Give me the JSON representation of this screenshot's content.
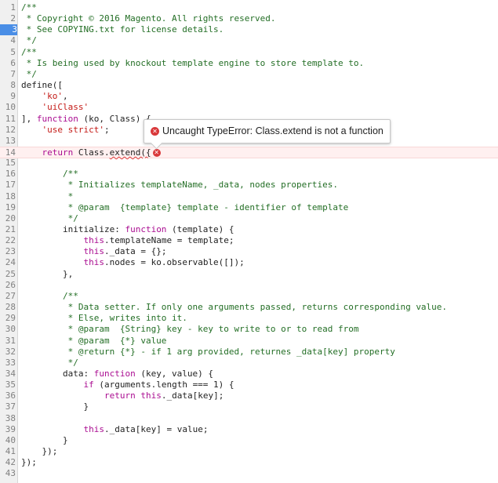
{
  "editor": {
    "active_line": 3,
    "error_line": 14,
    "lines": [
      [
        [
          "c",
          "/**"
        ]
      ],
      [
        [
          "c",
          " * Copyright © 2016 Magento. All rights reserved."
        ]
      ],
      [
        [
          "c",
          " * See COPYING.txt for license details."
        ]
      ],
      [
        [
          "c",
          " */"
        ]
      ],
      [
        [
          "c",
          "/**"
        ]
      ],
      [
        [
          "c",
          " * Is being used by knockout template engine to store template to."
        ]
      ],
      [
        [
          "c",
          " */"
        ]
      ],
      [
        [
          "t",
          "define(["
        ]
      ],
      [
        [
          "t",
          "    "
        ],
        [
          "s",
          "'ko'"
        ],
        [
          "t",
          ","
        ]
      ],
      [
        [
          "t",
          "    "
        ],
        [
          "s",
          "'uiClass'"
        ]
      ],
      [
        [
          "t",
          "], "
        ],
        [
          "k",
          "function"
        ],
        [
          "t",
          " (ko, Class) {"
        ]
      ],
      [
        [
          "t",
          "    "
        ],
        [
          "s",
          "'use strict'"
        ],
        [
          "t",
          ";"
        ]
      ],
      [],
      [
        [
          "t",
          "    "
        ],
        [
          "k",
          "return"
        ],
        [
          "t",
          " Class."
        ],
        [
          "squig",
          "extend({"
        ]
      ],
      [],
      [
        [
          "t",
          "        "
        ],
        [
          "c",
          "/**"
        ]
      ],
      [
        [
          "c",
          "         * Initializes templateName, _data, nodes properties."
        ]
      ],
      [
        [
          "c",
          "         *"
        ]
      ],
      [
        [
          "c",
          "         * @param  {template} template - identifier of template"
        ]
      ],
      [
        [
          "c",
          "         */"
        ]
      ],
      [
        [
          "t",
          "        initialize: "
        ],
        [
          "k",
          "function"
        ],
        [
          "t",
          " (template) {"
        ]
      ],
      [
        [
          "t",
          "            "
        ],
        [
          "k",
          "this"
        ],
        [
          "t",
          ".templateName = template;"
        ]
      ],
      [
        [
          "t",
          "            "
        ],
        [
          "k",
          "this"
        ],
        [
          "t",
          "._data = {};"
        ]
      ],
      [
        [
          "t",
          "            "
        ],
        [
          "k",
          "this"
        ],
        [
          "t",
          ".nodes = ko.observable([]);"
        ]
      ],
      [
        [
          "t",
          "        },"
        ]
      ],
      [],
      [
        [
          "t",
          "        "
        ],
        [
          "c",
          "/**"
        ]
      ],
      [
        [
          "c",
          "         * Data setter. If only one arguments passed, returns corresponding value."
        ]
      ],
      [
        [
          "c",
          "         * Else, writes into it."
        ]
      ],
      [
        [
          "c",
          "         * @param  {String} key - key to write to or to read from"
        ]
      ],
      [
        [
          "c",
          "         * @param  {*} value"
        ]
      ],
      [
        [
          "c",
          "         * @return {*} - if 1 arg provided, returnes _data[key] property"
        ]
      ],
      [
        [
          "c",
          "         */"
        ]
      ],
      [
        [
          "t",
          "        data: "
        ],
        [
          "k",
          "function"
        ],
        [
          "t",
          " (key, value) {"
        ]
      ],
      [
        [
          "t",
          "            "
        ],
        [
          "k",
          "if"
        ],
        [
          "t",
          " (arguments.length === 1) {"
        ]
      ],
      [
        [
          "t",
          "                "
        ],
        [
          "k",
          "return"
        ],
        [
          "t",
          " "
        ],
        [
          "k",
          "this"
        ],
        [
          "t",
          "._data[key];"
        ]
      ],
      [
        [
          "t",
          "            }"
        ]
      ],
      [],
      [
        [
          "t",
          "            "
        ],
        [
          "k",
          "this"
        ],
        [
          "t",
          "._data[key] = value;"
        ]
      ],
      [
        [
          "t",
          "        }"
        ]
      ],
      [
        [
          "t",
          "    });"
        ]
      ],
      [
        [
          "t",
          "});"
        ]
      ],
      []
    ]
  },
  "error_tooltip": {
    "icon": "error-icon",
    "message": "Uncaught TypeError: Class.extend is not a function",
    "color": "#d9383a"
  }
}
